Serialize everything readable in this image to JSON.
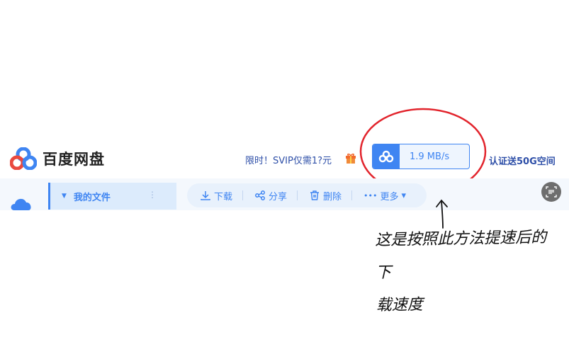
{
  "app": {
    "name": "百度网盘"
  },
  "header": {
    "promo_text": "限时！SVIP仅需1?元",
    "speed": "1.9 MB/s",
    "verify_text": "认证送50G空间"
  },
  "sidebar": {
    "items": [
      {
        "label": "我的文件",
        "caret": "▼",
        "menu": "⋮"
      }
    ]
  },
  "toolbar": {
    "download_label": "下载",
    "share_label": "分享",
    "delete_label": "删除",
    "more_label": "更多",
    "more_prefix": "•••",
    "more_caret": "▾"
  },
  "annotation": {
    "line1": "这是按照此方法提速后的下",
    "line2": "载速度"
  },
  "colors": {
    "accent": "#3f85f2",
    "annotation_red": "#e2242c",
    "promo_blue": "#2e4fa8"
  },
  "icons": [
    "cloud-logo-icon",
    "gift-icon",
    "speed-cloud-icon",
    "download-icon",
    "share-icon",
    "trash-icon",
    "doc-scan-icon",
    "arrow-icon"
  ]
}
